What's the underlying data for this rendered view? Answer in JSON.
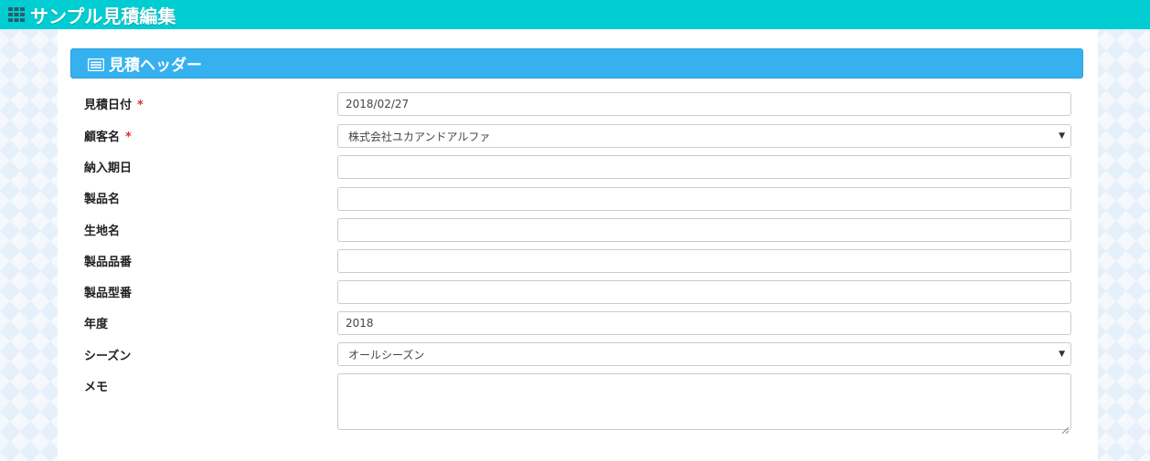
{
  "app": {
    "title": "サンプル見積編集"
  },
  "panel": {
    "title": "見積ヘッダー"
  },
  "fields": {
    "estimate_date": {
      "label": "見積日付",
      "required_mark": "*",
      "value": "2018/02/27"
    },
    "customer": {
      "label": "顧客名",
      "required_mark": "*",
      "value": "株式会社ユカアンドアルファ",
      "caret": "▼"
    },
    "delivery_date": {
      "label": "納入期日",
      "value": ""
    },
    "product_name": {
      "label": "製品名",
      "value": ""
    },
    "fabric_name": {
      "label": "生地名",
      "value": ""
    },
    "product_number": {
      "label": "製品品番",
      "value": ""
    },
    "product_model": {
      "label": "製品型番",
      "value": ""
    },
    "year": {
      "label": "年度",
      "value": "2018"
    },
    "season": {
      "label": "シーズン",
      "value": "オールシーズン",
      "caret": "▼"
    },
    "memo": {
      "label": "メモ",
      "value": ""
    }
  },
  "colors": {
    "topbar": "#00cdd2",
    "header": "#36b1f0",
    "required": "#d9302f"
  }
}
